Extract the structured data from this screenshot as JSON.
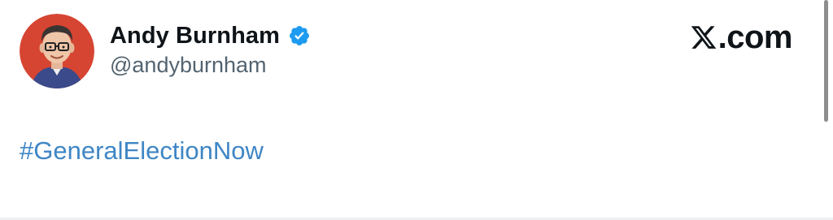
{
  "author": {
    "display_name": "Andy Burnham",
    "handle": "@andyburnham",
    "verified": true,
    "verified_color": "#1d9bf0",
    "avatar_bg_color": "#d64532"
  },
  "brand": {
    "icon": "x-logo-icon",
    "text": ".com"
  },
  "post": {
    "text": "#GeneralElectionNow",
    "link_color": "#3f86c5"
  },
  "icons": {
    "verified": "verified-badge-icon",
    "avatar": "cartoon-portrait-avatar"
  }
}
